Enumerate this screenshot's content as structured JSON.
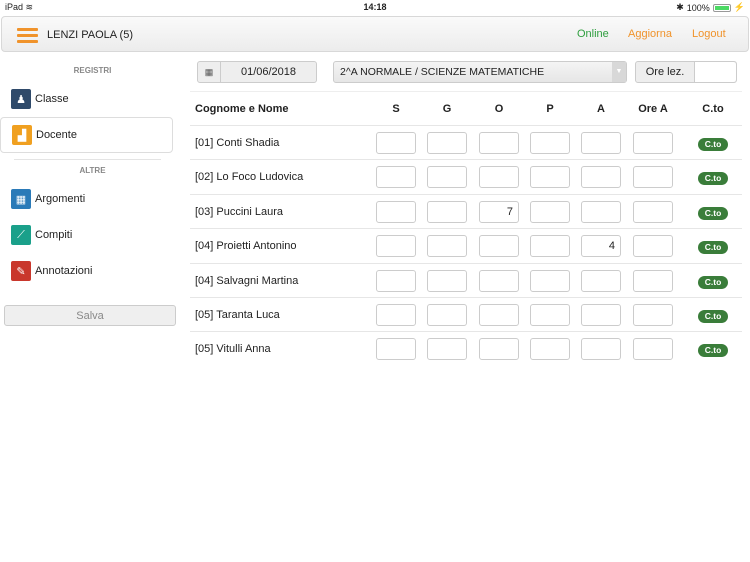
{
  "status": {
    "device": "iPad",
    "time": "14:18",
    "battery": "100%",
    "battery_level": 1.0
  },
  "header": {
    "title": "LENZI PAOLA (5)",
    "online": "Online",
    "refresh": "Aggiorna",
    "logout": "Logout",
    "colors": {
      "online": "#2e9e3e",
      "accent": "#f0932b"
    }
  },
  "sidebar": {
    "section1": "REGISTRI",
    "items1": [
      {
        "label": "Classe",
        "icon": "class-icon",
        "color": "#2f4a6a"
      },
      {
        "label": "Docente",
        "icon": "teacher-icon",
        "color": "#f0a020"
      }
    ],
    "section2": "ALTRE",
    "items2": [
      {
        "label": "Argomenti",
        "icon": "topics-icon",
        "color": "#2a7ab8"
      },
      {
        "label": "Compiti",
        "icon": "homework-icon",
        "color": "#1aa08a"
      },
      {
        "label": "Annotazioni",
        "icon": "notes-icon",
        "color": "#c9372c"
      }
    ],
    "save": "Salva"
  },
  "toolbar": {
    "date": "01/06/2018",
    "class_select": "2^A NORMALE / SCIENZE MATEMATICHE",
    "ore_label": "Ore lez.",
    "ore_value": ""
  },
  "table": {
    "headers": [
      "Cognome e Nome",
      "S",
      "G",
      "O",
      "P",
      "A",
      "Ore A",
      "C.to"
    ],
    "rows": [
      {
        "name": "[01] Conti Shadia",
        "S": "",
        "G": "",
        "O": "",
        "P": "",
        "A": "",
        "OreA": "",
        "cto": "C.to"
      },
      {
        "name": "[02] Lo Foco Ludovica",
        "S": "",
        "G": "",
        "O": "",
        "P": "",
        "A": "",
        "OreA": "",
        "cto": "C.to"
      },
      {
        "name": "[03] Puccini Laura",
        "S": "",
        "G": "",
        "O": "7",
        "P": "",
        "A": "",
        "OreA": "",
        "cto": "C.to"
      },
      {
        "name": "[04] Proietti Antonino",
        "S": "",
        "G": "",
        "O": "",
        "P": "",
        "A": "4",
        "OreA": "",
        "cto": "C.to"
      },
      {
        "name": "[04] Salvagni Martina",
        "S": "",
        "G": "",
        "O": "",
        "P": "",
        "A": "",
        "OreA": "",
        "cto": "C.to"
      },
      {
        "name": "[05] Taranta Luca",
        "S": "",
        "G": "",
        "O": "",
        "P": "",
        "A": "",
        "OreA": "",
        "cto": "C.to"
      },
      {
        "name": "[05] Vitulli Anna",
        "S": "",
        "G": "",
        "O": "",
        "P": "",
        "A": "",
        "OreA": "",
        "cto": "C.to"
      }
    ]
  }
}
